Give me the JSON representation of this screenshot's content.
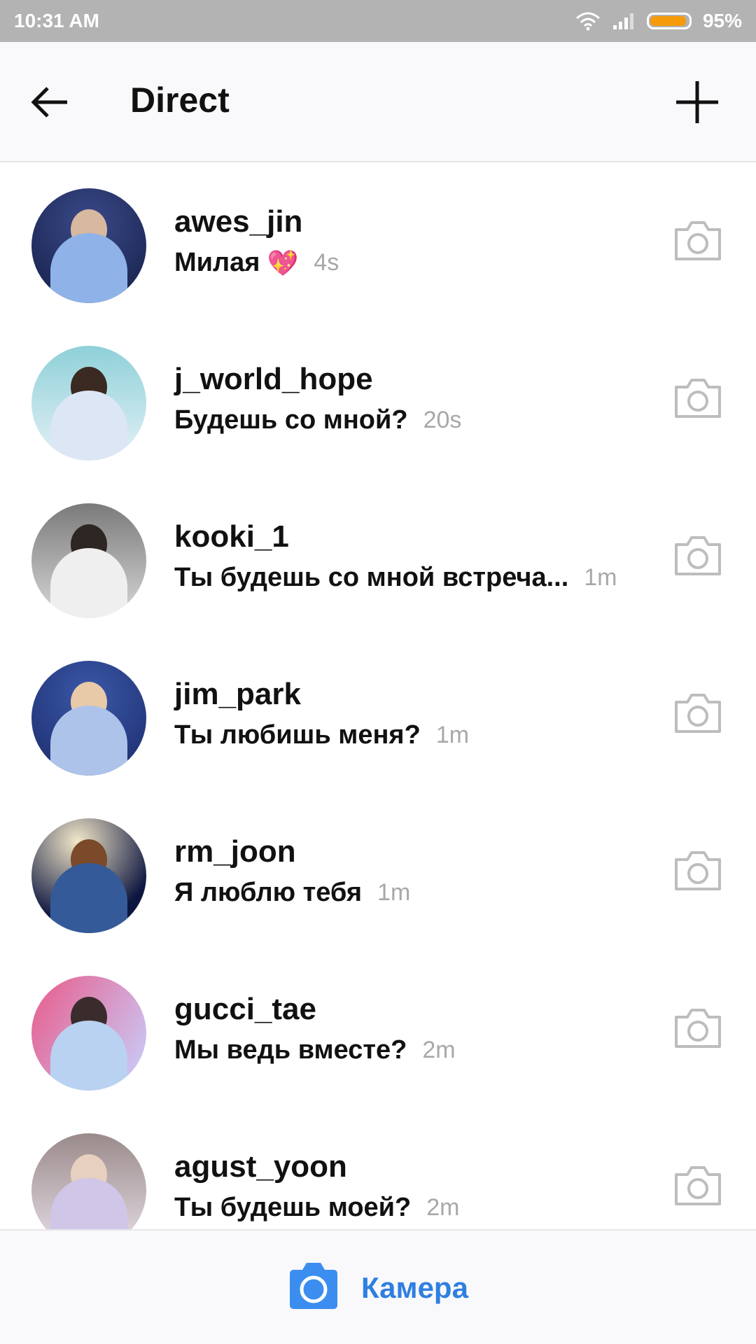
{
  "status_bar": {
    "time": "10:31 AM",
    "battery": "95%",
    "battery_level": 0.95,
    "icons": [
      "wifi-icon",
      "signal-icon",
      "battery-icon"
    ]
  },
  "header": {
    "title": "Direct",
    "back_icon": "arrow-left-icon",
    "add_icon": "plus-icon"
  },
  "conversations": [
    {
      "username": "awes_jin",
      "message": "Милая",
      "emoji": "💖",
      "time": "4s"
    },
    {
      "username": "j_world_hope",
      "message": "Будешь со мной?",
      "time": "20s"
    },
    {
      "username": "kooki_1",
      "message": "Ты будешь со мной встреча...",
      "time": "1m"
    },
    {
      "username": "jim_park",
      "message": "Ты любишь меня?",
      "time": "1m"
    },
    {
      "username": "rm_joon",
      "message": "Я люблю тебя",
      "time": "1m"
    },
    {
      "username": "gucci_tae",
      "message": "Мы ведь вместе?",
      "time": "2m"
    },
    {
      "username": "agust_yoon",
      "message": "Ты будешь моей?",
      "time": "2m"
    }
  ],
  "bottom": {
    "camera_label": "Камера",
    "camera_icon": "camera-icon"
  },
  "colors": {
    "accent": "#2f7fe0",
    "status_bar": "#b3b3b3",
    "battery": "#f59a0b",
    "timestamp": "#a8a8a8"
  }
}
